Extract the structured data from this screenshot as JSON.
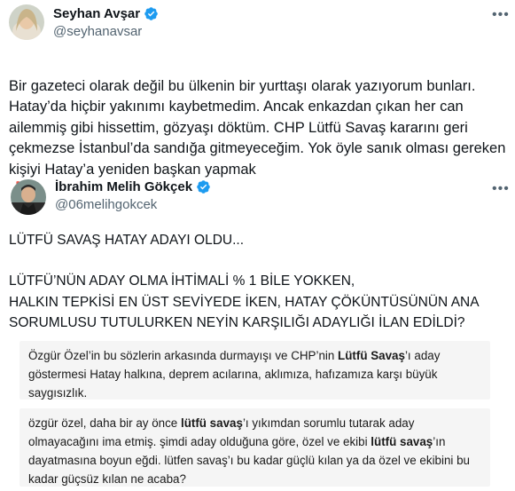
{
  "tweet": {
    "author_name": "Seyhan Avşar",
    "author_handle": "@seyhanavsar",
    "more_icon": "more-horizontal-icon",
    "body": "Bir gazeteci olarak değil bu ülkenin bir yurttaşı olarak yazıyorum bunları. Hatay’da hiçbir yakınımı kaybetmedim. Ancak enkazdan çıkan her can ailemmiş gibi hissettim, gözyaşı döktüm. CHP Lütfü Savaş kararını geri çekmezse İstanbul’da sandığa gitmeyeceğim. Yok öyle sanık olması gereken kişiyi Hatay’a yeniden başkan yapmak",
    "emoji": "❗"
  },
  "quoted": {
    "author_name": "İbrahim Melih Gökçek",
    "author_handle": "@06melihgokcek",
    "more_icon": "more-horizontal-icon",
    "line1": "LÜTFÜ SAVAŞ HATAY ADAYI OLDU...",
    "line2": "LÜTFÜ’NÜN ADAY OLMA İHTİMALİ % 1 BİLE YOKKEN,\nHALKIN TEPKİSİ EN ÜST SEVİYEDE İKEN, HATAY ÇÖKÜNTÜSÜNÜN ANA SORUMLUSU TUTULURKEN NEYİN KARŞILIĞI ADAYLIĞI İLAN EDİLDİ?",
    "card1": {
      "pre": "Özgür Özel’in bu sözlerin arkasında durmayışı ve CHP’nin ",
      "bold": "Lütfü Savaş",
      "post": "’ı aday göstermesi Hatay halkına, deprem acılarına, aklımıza, hafızamıza karşı büyük saygısızlık."
    },
    "card2": {
      "t1": "özgür özel, daha bir ay önce ",
      "b1": "lütfü savaş",
      "t2": "’ı yıkımdan sorumlu tutarak aday olmayacağını ima etmiş. şimdi aday olduğuna göre, özel ve ekibi ",
      "b2": "lütfü savaş",
      "t3": "’ın dayatmasına boyun eğdi. lütfen savaş’ı bu kadar güçlü kılan ya da özel ve ekibini bu kadar güçsüz kılan ne acaba?"
    }
  },
  "colors": {
    "verified": "#1d9bf0",
    "secondary_text": "#536471",
    "card_bg": "#f5f5f5"
  }
}
